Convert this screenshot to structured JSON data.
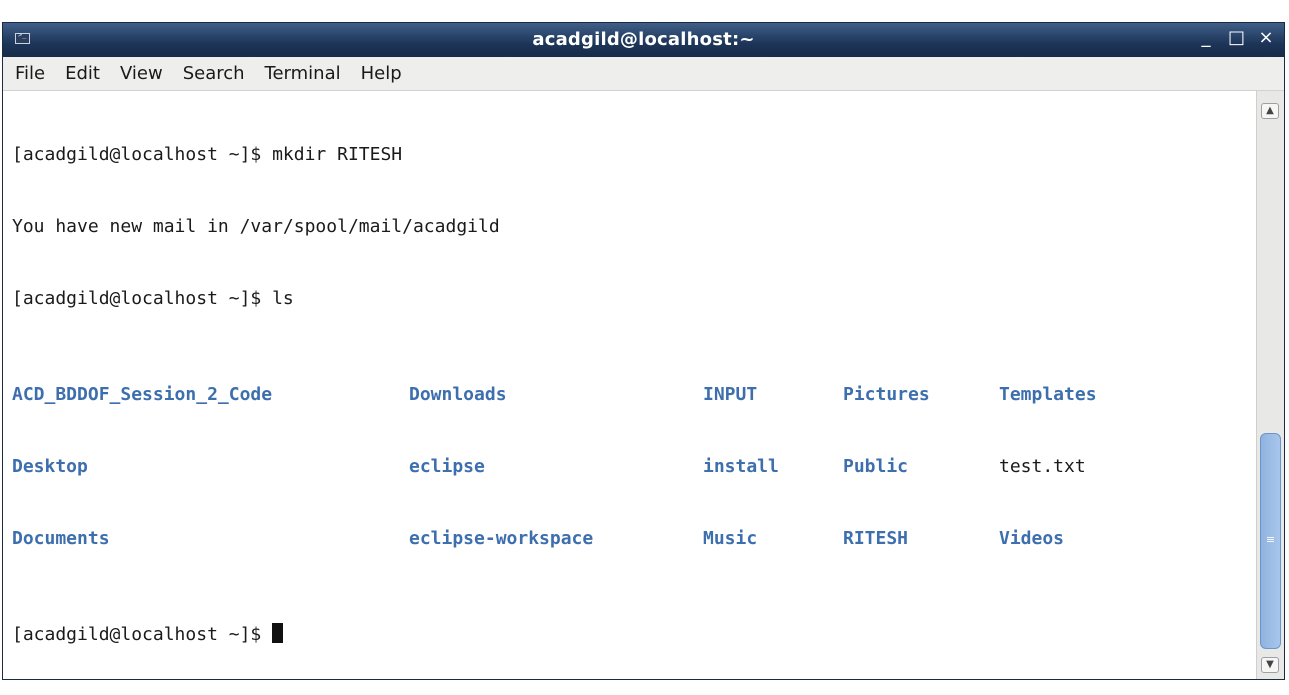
{
  "window": {
    "title": "acadgild@localhost:~",
    "controls": {
      "minimize": "_",
      "maximize": "□",
      "close": "×"
    }
  },
  "menu": [
    "File",
    "Edit",
    "View",
    "Search",
    "Terminal",
    "Help"
  ],
  "terminal": {
    "lines": [
      "[acadgild@localhost ~]$ mkdir RITESH",
      "You have new mail in /var/spool/mail/acadgild",
      "[acadgild@localhost ~]$ ls"
    ],
    "ls_output": [
      [
        {
          "text": "ACD_BDDOF_Session_2_Code",
          "type": "dir"
        },
        {
          "text": "Downloads",
          "type": "dir"
        },
        {
          "text": "INPUT",
          "type": "dir"
        },
        {
          "text": "Pictures",
          "type": "dir"
        },
        {
          "text": "Templates",
          "type": "dir"
        }
      ],
      [
        {
          "text": "Desktop",
          "type": "dir"
        },
        {
          "text": "eclipse",
          "type": "dir"
        },
        {
          "text": "install",
          "type": "dir"
        },
        {
          "text": "Public",
          "type": "dir"
        },
        {
          "text": "test.txt",
          "type": "file"
        }
      ],
      [
        {
          "text": "Documents",
          "type": "dir"
        },
        {
          "text": "eclipse-workspace",
          "type": "dir"
        },
        {
          "text": "Music",
          "type": "dir"
        },
        {
          "text": "RITESH",
          "type": "dir"
        },
        {
          "text": "Videos",
          "type": "dir"
        }
      ]
    ],
    "prompt": "[acadgild@localhost ~]$ "
  },
  "colors": {
    "directory": "#3d6fae",
    "titlebar": "#1d3558",
    "scroll_thumb": "#a8c6ec"
  },
  "icons": {
    "window_icon": "terminal-icon",
    "scroll_up": "chevron-up-icon",
    "scroll_down": "chevron-down-icon",
    "scroll_grip": "grip-icon"
  }
}
